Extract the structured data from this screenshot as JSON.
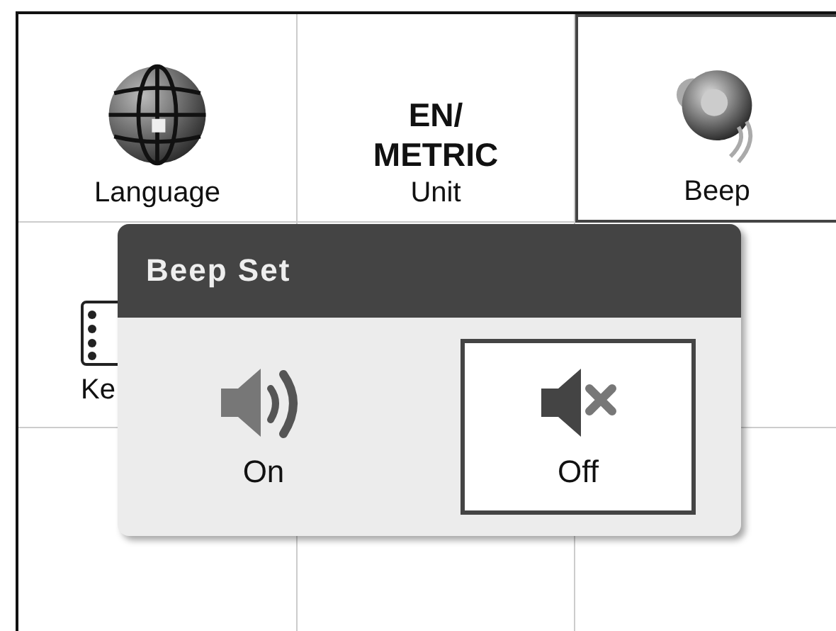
{
  "grid": {
    "cells": [
      {
        "kind": "globe",
        "label": "Language",
        "selected": false
      },
      {
        "kind": "text",
        "value_lines": [
          "EN/",
          "METRIC"
        ],
        "label": "Unit",
        "selected": false
      },
      {
        "kind": "speaker",
        "label": "Beep",
        "selected": true
      },
      {
        "kind": "keypad",
        "label": "Ke",
        "selected": false
      }
    ]
  },
  "dialog": {
    "title": "Beep Set",
    "options": [
      {
        "kind": "sound",
        "label": "On",
        "selected": false
      },
      {
        "kind": "mute",
        "label": "Off",
        "selected": true
      }
    ]
  }
}
